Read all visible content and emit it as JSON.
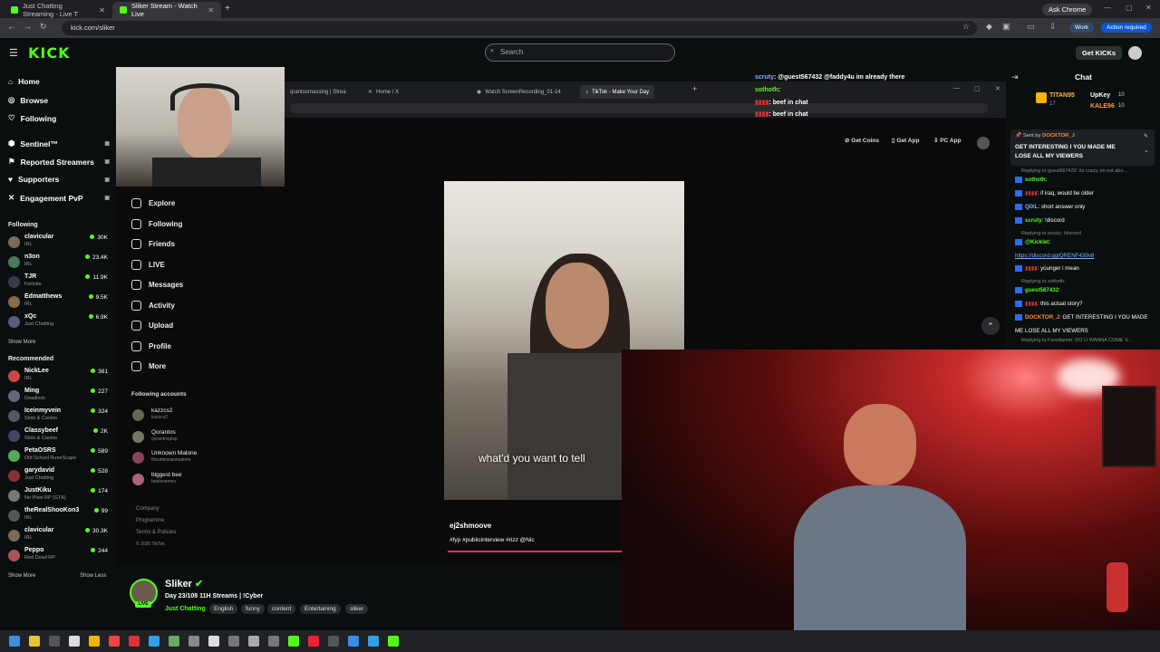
{
  "browser": {
    "tabs": [
      {
        "title": "Just Chatting Streaming - Live T",
        "active": false
      },
      {
        "title": "Sliker Stream - Watch Live",
        "active": true
      }
    ],
    "url": "kick.com/sliker",
    "ask_chrome": "Ask Chrome",
    "profile": "Work",
    "action_required": "Action required"
  },
  "header": {
    "logo": "KICK",
    "search_placeholder": "Search",
    "get_kicks": "Get KICKs",
    "chat_title": "Chat"
  },
  "sidebar": {
    "nav": [
      {
        "label": "Home",
        "icon": "home-icon"
      },
      {
        "label": "Browse",
        "icon": "compass-icon"
      },
      {
        "label": "Following",
        "icon": "heart-icon"
      }
    ],
    "tools": [
      {
        "label": "Sentinel™",
        "icon": "shield-icon"
      },
      {
        "label": "Reported Streamers",
        "icon": "flag-icon"
      },
      {
        "label": "Supporters",
        "icon": "heart-icon"
      },
      {
        "label": "Engagement PvP",
        "icon": "swords-icon"
      }
    ],
    "following_title": "Following",
    "following": [
      {
        "name": "clavicular",
        "category": "IRL",
        "viewers": "30K"
      },
      {
        "name": "n3on",
        "category": "IRL",
        "viewers": "23.4K"
      },
      {
        "name": "TJR",
        "category": "Fortnite",
        "viewers": "11.9K"
      },
      {
        "name": "Edmatthews",
        "category": "IRL",
        "viewers": "9.5K"
      },
      {
        "name": "xQc",
        "category": "Just Chatting",
        "viewers": "6.9K"
      }
    ],
    "show_more": "Show More",
    "recommended_title": "Recommended",
    "recommended": [
      {
        "name": "NickLee",
        "category": "IRL",
        "viewers": "381"
      },
      {
        "name": "Ming",
        "category": "Deadlock",
        "viewers": "227"
      },
      {
        "name": "Iceinmyvein",
        "category": "Slots & Casino",
        "viewers": "324"
      },
      {
        "name": "Classybeef",
        "category": "Slots & Casino",
        "viewers": "2K"
      },
      {
        "name": "PetaOSRS",
        "category": "Old School RuneScape",
        "viewers": "589"
      },
      {
        "name": "garydavid",
        "category": "Just Chatting",
        "viewers": "528"
      },
      {
        "name": "JustKiku",
        "category": "No Pixel RP (GTA)",
        "viewers": "174"
      },
      {
        "name": "theRealShooKon3",
        "category": "IRL",
        "viewers": "99"
      },
      {
        "name": "clavicular",
        "category": "IRL",
        "viewers": "30.3K"
      },
      {
        "name": "Peppo",
        "category": "Red Dead RP",
        "viewers": "244"
      }
    ],
    "show_more_2": "Show More",
    "show_less": "Show Less"
  },
  "inner_browser": {
    "tabs": [
      {
        "title": "qrantosmassing | Strea"
      },
      {
        "title": "Home / X"
      },
      {
        "title": "Watch ScreenRecording_01-14"
      },
      {
        "title": "TikTok - Make Your Day"
      }
    ]
  },
  "tiktok": {
    "nav": [
      "Explore",
      "Following",
      "Friends",
      "LIVE",
      "Messages",
      "Activity",
      "Upload",
      "Profile",
      "More"
    ],
    "following_accounts_title": "Following accounts",
    "accounts": [
      {
        "name": "kazzcs2",
        "handle": "kazzcs2"
      },
      {
        "name": "Qorantos",
        "handle": "qorantosplsp"
      },
      {
        "name": "Unknown Malone",
        "handle": "theunknownmalone"
      },
      {
        "name": "biggest bee",
        "handle": "beelovemes"
      }
    ],
    "footer": [
      "Company",
      "Programme",
      "Terms & Policies",
      "© 2026 TikTok"
    ],
    "top_buttons": [
      "Get Coins",
      "Get App",
      "PC App"
    ],
    "caption": "what'd you want to tell",
    "video_user": "ej2shmoove",
    "video_tags": "#fyp #publicinterview #rizz @Nic",
    "progress": 0.42
  },
  "stream": {
    "name": "Sliker",
    "live_badge": "LIVE",
    "title": "Day 23/108 11H Streams | !Cyber",
    "category": "Just Chatting",
    "tags": [
      "English",
      "funny",
      "content",
      "Entertaining",
      "sliker"
    ]
  },
  "overlay_chat": [
    {
      "user": "scruty",
      "text": ": @guest567432 @faddy4u im already there"
    },
    {
      "user": "sothoth",
      "text": ":"
    },
    {
      "user": "",
      "text": ": beef in chat"
    },
    {
      "user": "",
      "text": ": beef in chat"
    }
  ],
  "chat": {
    "leaderboard": [
      {
        "name": "TITAN95",
        "score": "17"
      },
      {
        "name": "UpKey",
        "score": "10"
      },
      {
        "name": "KALE96",
        "score": "10"
      }
    ],
    "pinned_by_label": "Sent by",
    "pinned_by": "DOCKTOR_J",
    "pinned_text_1": "GET INTERESTING I YOU MADE ME",
    "pinned_text_2": "LOSE ALL MY VIEWERS",
    "messages": [
      {
        "reply": "Replying to guest567432: its crazy, im not abo..."
      },
      {
        "user": "sothoth",
        "text": ":",
        "color": "g"
      },
      {
        "user": "",
        "text": ": if iraq, would be older",
        "color": "p"
      },
      {
        "user": "QIXL",
        "text": ": short answer only",
        "color": "b"
      },
      {
        "user": "scruty",
        "text": ": !discord",
        "color": "g"
      },
      {
        "reply": "Replying to scruty: !discord"
      },
      {
        "user": "@Kicklet",
        "text": ":",
        "color": "g"
      },
      {
        "link": "https://discord.gg/QRENF439v8"
      },
      {
        "user": "",
        "text": ": younger i mean",
        "color": "p"
      },
      {
        "reply": "Replying to sothoth:"
      },
      {
        "user": "guest567432",
        "text": ":",
        "color": "g"
      },
      {
        "user": "",
        "text": ": this actual story?",
        "color": "p"
      },
      {
        "user": "DOCKTOR_J",
        "text": ": GET INTERESTING I YOU MADE",
        "color": "p"
      },
      {
        "text": "ME LOSE ALL MY VIEWERS"
      },
      {
        "reply": "Replying to Fanidiamm: DO U WANNA COME V..."
      }
    ]
  }
}
